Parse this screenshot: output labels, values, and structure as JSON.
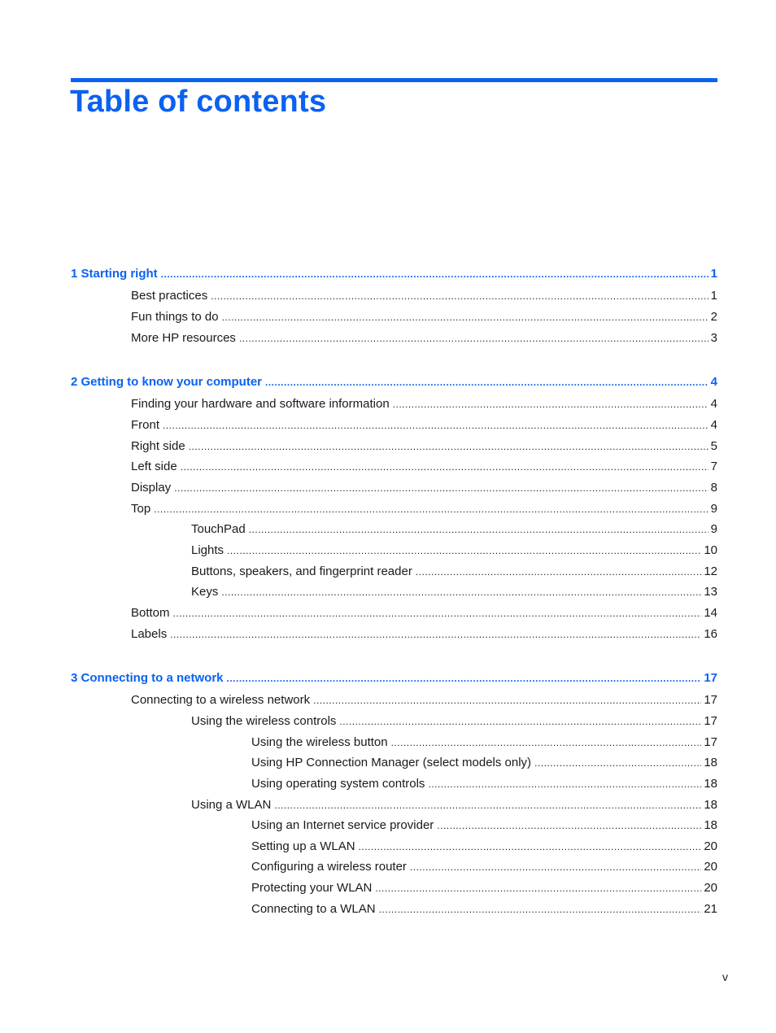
{
  "title": "Table of contents",
  "page_number": "v",
  "entries": [
    {
      "level": 0,
      "label": "1  Starting right",
      "page": "1"
    },
    {
      "level": 1,
      "label": "Best practices",
      "page": "1"
    },
    {
      "level": 1,
      "label": "Fun things to do",
      "page": "2"
    },
    {
      "level": 1,
      "label": "More HP resources",
      "page": "3"
    },
    {
      "level": 0,
      "label": "2  Getting to know your computer",
      "page": "4"
    },
    {
      "level": 1,
      "label": "Finding your hardware and software information",
      "page": "4"
    },
    {
      "level": 1,
      "label": "Front",
      "page": "4"
    },
    {
      "level": 1,
      "label": "Right side",
      "page": "5"
    },
    {
      "level": 1,
      "label": "Left side",
      "page": "7"
    },
    {
      "level": 1,
      "label": "Display",
      "page": "8"
    },
    {
      "level": 1,
      "label": "Top",
      "page": "9"
    },
    {
      "level": 2,
      "label": "TouchPad",
      "page": "9"
    },
    {
      "level": 2,
      "label": "Lights",
      "page": "10"
    },
    {
      "level": 2,
      "label": "Buttons, speakers, and fingerprint reader",
      "page": "12"
    },
    {
      "level": 2,
      "label": "Keys",
      "page": "13"
    },
    {
      "level": 1,
      "label": "Bottom",
      "page": "14"
    },
    {
      "level": 1,
      "label": "Labels",
      "page": "16"
    },
    {
      "level": 0,
      "label": "3  Connecting to a network",
      "page": "17"
    },
    {
      "level": 1,
      "label": "Connecting to a wireless network",
      "page": "17"
    },
    {
      "level": 2,
      "label": "Using the wireless controls",
      "page": "17"
    },
    {
      "level": 3,
      "label": "Using the wireless button",
      "page": "17"
    },
    {
      "level": 3,
      "label": "Using HP Connection Manager (select models only)",
      "page": "18"
    },
    {
      "level": 3,
      "label": "Using operating system controls",
      "page": "18"
    },
    {
      "level": 2,
      "label": "Using a WLAN",
      "page": "18"
    },
    {
      "level": 3,
      "label": "Using an Internet service provider",
      "page": "18"
    },
    {
      "level": 3,
      "label": "Setting up a WLAN",
      "page": "20"
    },
    {
      "level": 3,
      "label": "Configuring a wireless router",
      "page": "20"
    },
    {
      "level": 3,
      "label": "Protecting your WLAN",
      "page": "20"
    },
    {
      "level": 3,
      "label": "Connecting to a WLAN",
      "page": "21"
    }
  ]
}
